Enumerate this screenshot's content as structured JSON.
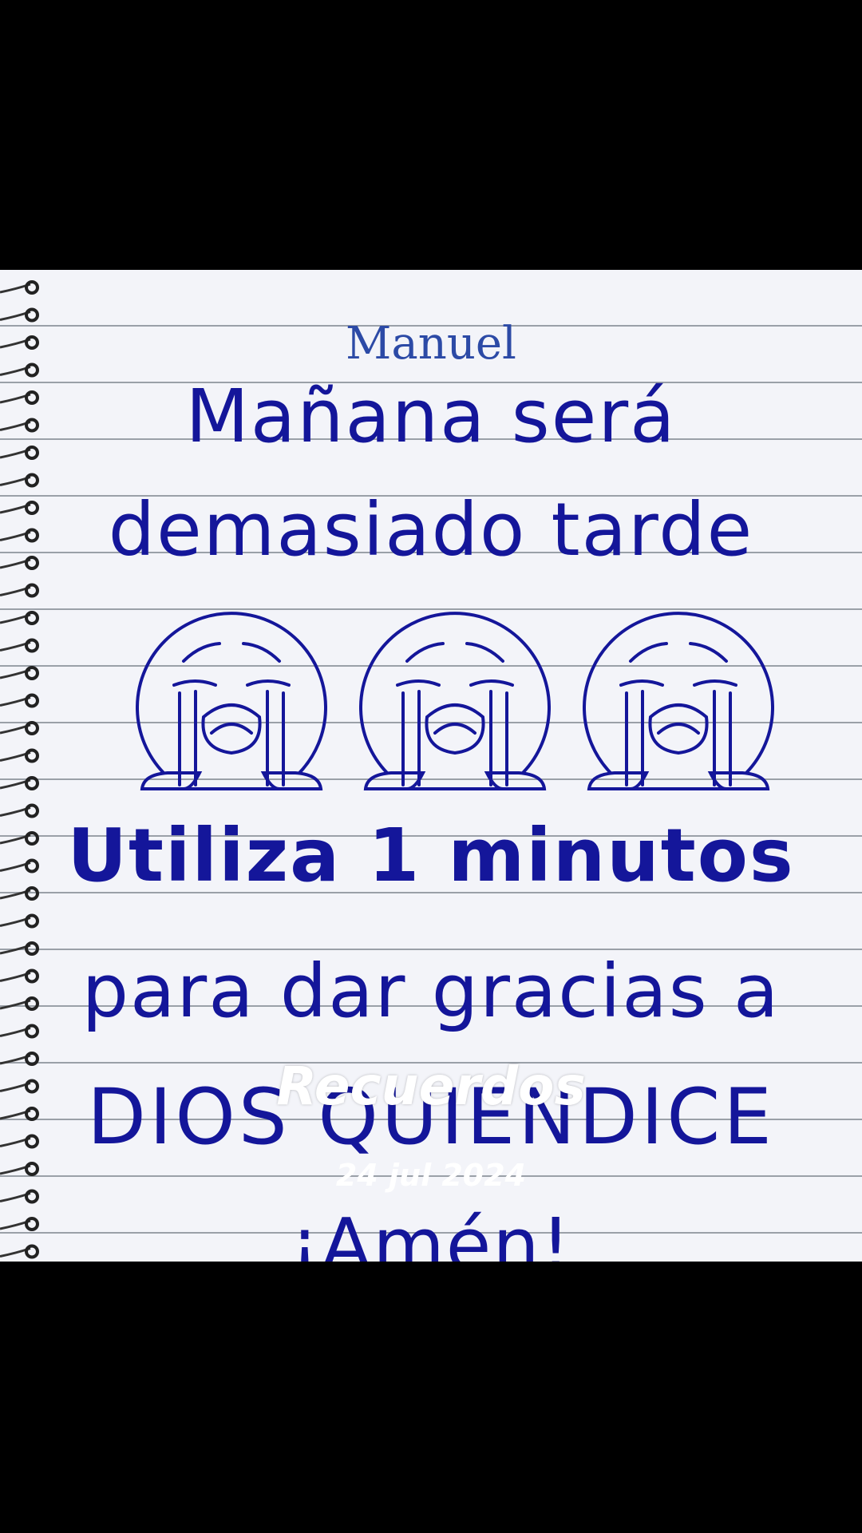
{
  "colors": {
    "ink": "#14169a",
    "paper": "#f3f4f9",
    "rule": "#9aa0a8",
    "caption": "#2c4aa6",
    "background": "#000000"
  },
  "post": {
    "author": "Manuel",
    "overlay_title": "Recuerdos",
    "overlay_date": "24 jul 2024"
  },
  "note": {
    "line1": "Mañana será",
    "line2": "demasiado tarde",
    "line3": "Utiliza 1 minutos",
    "line4": "para dar gracias a",
    "line5": "DIOS QUIENDICE",
    "line6": "¡Amén!",
    "emoji_icon": "crying-face-icon",
    "emoji_count": 3
  }
}
